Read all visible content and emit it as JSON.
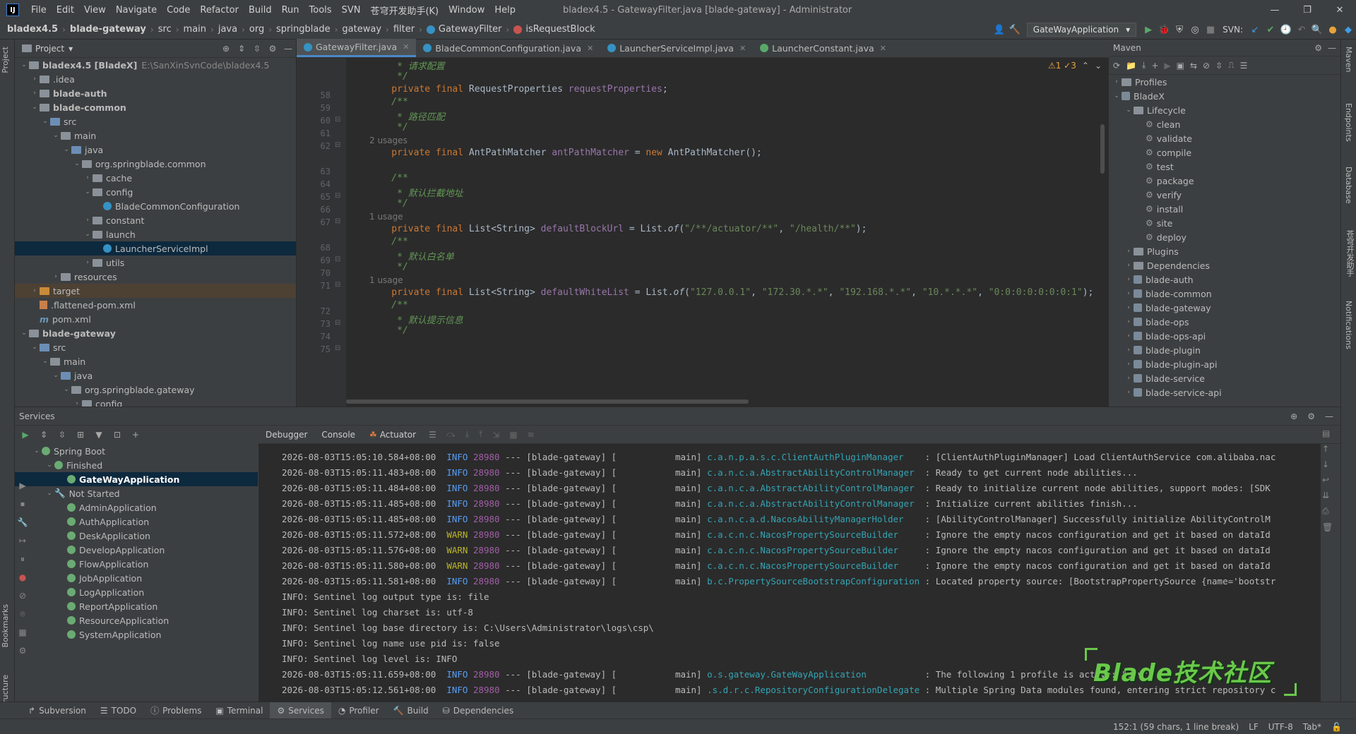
{
  "menubar": {
    "items": [
      "File",
      "Edit",
      "View",
      "Navigate",
      "Code",
      "Refactor",
      "Build",
      "Run",
      "Tools",
      "SVN",
      "苍穹开发助手(K)",
      "Window",
      "Help"
    ],
    "title": "bladex4.5 - GatewayFilter.java [blade-gateway] - Administrator"
  },
  "navbar": {
    "crumbs": [
      "bladex4.5",
      "blade-gateway",
      "src",
      "main",
      "java",
      "org",
      "springblade",
      "gateway",
      "filter",
      "GatewayFilter",
      "isRequestBlock"
    ],
    "run_config": "GateWayApplication",
    "svn_label": "SVN:"
  },
  "project": {
    "title": "Project",
    "items": [
      {
        "label": "bladex4.5 [BladeX]",
        "extra": "E:\\SanXinSvnCode\\bladex4.5",
        "bold": true
      },
      {
        "label": ".idea"
      },
      {
        "label": "blade-auth",
        "bold": true
      },
      {
        "label": "blade-common",
        "bold": true
      },
      {
        "label": "src"
      },
      {
        "label": "main"
      },
      {
        "label": "java"
      },
      {
        "label": "org.springblade.common"
      },
      {
        "label": "cache"
      },
      {
        "label": "config"
      },
      {
        "label": "BladeCommonConfiguration"
      },
      {
        "label": "constant"
      },
      {
        "label": "launch"
      },
      {
        "label": "LauncherServiceImpl"
      },
      {
        "label": "utils"
      },
      {
        "label": "resources"
      },
      {
        "label": "target"
      },
      {
        "label": ".flattened-pom.xml"
      },
      {
        "label": "pom.xml"
      },
      {
        "label": "blade-gateway",
        "bold": true
      },
      {
        "label": "src"
      },
      {
        "label": "main"
      },
      {
        "label": "java"
      },
      {
        "label": "org.springblade.gateway"
      },
      {
        "label": "config"
      }
    ]
  },
  "editor": {
    "tabs": [
      "GatewayFilter.java",
      "BladeCommonConfiguration.java",
      "LauncherServiceImpl.java",
      "LauncherConstant.java"
    ],
    "warnings": "⚠1 ✓3",
    "lines": [
      {
        "n": "",
        "t": "cm",
        "code": "     * 请求配置"
      },
      {
        "n": "58",
        "t": "cm",
        "code": "     */"
      },
      {
        "n": "59",
        "t": "code1",
        "code": ""
      },
      {
        "n": "60",
        "t": "cm",
        "code": "    /**"
      },
      {
        "n": "61",
        "t": "cm",
        "code": "     * 路径匹配"
      },
      {
        "n": "62",
        "t": "cm",
        "code": "     */"
      },
      {
        "n": "",
        "t": "usage",
        "code": "2 usages"
      },
      {
        "n": "63",
        "t": "code2",
        "code": ""
      },
      {
        "n": "64",
        "t": "blank",
        "code": ""
      },
      {
        "n": "65",
        "t": "cm",
        "code": "    /**"
      },
      {
        "n": "66",
        "t": "cm",
        "code": "     * 默认拦截地址"
      },
      {
        "n": "67",
        "t": "cm",
        "code": "     */"
      },
      {
        "n": "",
        "t": "usage",
        "code": "1 usage"
      },
      {
        "n": "68",
        "t": "code3",
        "code": ""
      },
      {
        "n": "69",
        "t": "cm",
        "code": "    /**"
      },
      {
        "n": "70",
        "t": "cm",
        "code": "     * 默认白名单"
      },
      {
        "n": "71",
        "t": "cm",
        "code": "     */"
      },
      {
        "n": "",
        "t": "usage",
        "code": "1 usage"
      },
      {
        "n": "72",
        "t": "code4",
        "code": ""
      },
      {
        "n": "73",
        "t": "cm",
        "code": "    /**"
      },
      {
        "n": "74",
        "t": "cm",
        "code": "     * 默认提示信息"
      },
      {
        "n": "75",
        "t": "cm",
        "code": "     */"
      }
    ],
    "code1": {
      "kw": "    private final ",
      "type": "RequestProperties ",
      "field": "requestProperties",
      ";": ";"
    },
    "code2": {
      "kw": "    private final ",
      "type": "AntPathMatcher ",
      "field": "antPathMatcher",
      "rest1": " = ",
      "new": "new ",
      "rest2": "AntPathMatcher();"
    },
    "code3": {
      "kw": "    private final ",
      "type": "List<String> ",
      "field": "defaultBlockUrl",
      "rest1": " = List.",
      "of": "of",
      "rest2": "(",
      "s1": "\"/**/actuator/**\"",
      "c": ", ",
      "s2": "\"/health/**\"",
      "end": ");"
    },
    "code4": {
      "kw": "    private final ",
      "type": "List<String> ",
      "field": "defaultWhiteList",
      "rest1": " = List.",
      "of": "of",
      "rest2": "(",
      "s1": "\"127.0.0.1\"",
      "c1": ", ",
      "s2": "\"172.30.*.*\"",
      "c2": ", ",
      "s3": "\"192.168.*.*\"",
      "c3": ", ",
      "s4": "\"10.*.*.*\"",
      "c4": ", ",
      "s5": "\"0:0:0:0:0:0:0:1\"",
      "end": ");"
    }
  },
  "maven": {
    "title": "Maven",
    "items": [
      {
        "label": "Profiles",
        "lvl": 0,
        "kind": "folder",
        "arr": "›"
      },
      {
        "label": "BladeX",
        "lvl": 0,
        "kind": "mvn",
        "arr": "⌄"
      },
      {
        "label": "Lifecycle",
        "lvl": 1,
        "kind": "folder",
        "arr": "⌄"
      },
      {
        "label": "clean",
        "lvl": 2,
        "kind": "gear"
      },
      {
        "label": "validate",
        "lvl": 2,
        "kind": "gear"
      },
      {
        "label": "compile",
        "lvl": 2,
        "kind": "gear"
      },
      {
        "label": "test",
        "lvl": 2,
        "kind": "gear"
      },
      {
        "label": "package",
        "lvl": 2,
        "kind": "gear"
      },
      {
        "label": "verify",
        "lvl": 2,
        "kind": "gear"
      },
      {
        "label": "install",
        "lvl": 2,
        "kind": "gear"
      },
      {
        "label": "site",
        "lvl": 2,
        "kind": "gear"
      },
      {
        "label": "deploy",
        "lvl": 2,
        "kind": "gear"
      },
      {
        "label": "Plugins",
        "lvl": 1,
        "kind": "folder",
        "arr": "›"
      },
      {
        "label": "Dependencies",
        "lvl": 1,
        "kind": "folder",
        "arr": "›"
      },
      {
        "label": "blade-auth",
        "lvl": 1,
        "kind": "mvn",
        "arr": "›"
      },
      {
        "label": "blade-common",
        "lvl": 1,
        "kind": "mvn",
        "arr": "›"
      },
      {
        "label": "blade-gateway",
        "lvl": 1,
        "kind": "mvn",
        "arr": "›"
      },
      {
        "label": "blade-ops",
        "lvl": 1,
        "kind": "mvn",
        "arr": "›"
      },
      {
        "label": "blade-ops-api",
        "lvl": 1,
        "kind": "mvn",
        "arr": "›"
      },
      {
        "label": "blade-plugin",
        "lvl": 1,
        "kind": "mvn",
        "arr": "›"
      },
      {
        "label": "blade-plugin-api",
        "lvl": 1,
        "kind": "mvn",
        "arr": "›"
      },
      {
        "label": "blade-service",
        "lvl": 1,
        "kind": "mvn",
        "arr": "›"
      },
      {
        "label": "blade-service-api",
        "lvl": 1,
        "kind": "mvn",
        "arr": "›"
      }
    ]
  },
  "services": {
    "title": "Services",
    "tree": [
      {
        "label": "Spring Boot",
        "lvl": 0,
        "arr": "⌄"
      },
      {
        "label": "Finished",
        "lvl": 1,
        "arr": "⌄"
      },
      {
        "label": "GateWayApplication",
        "lvl": 2,
        "sel": true
      },
      {
        "label": "Not Started",
        "lvl": 1,
        "arr": "⌄"
      },
      {
        "label": "AdminApplication",
        "lvl": 2
      },
      {
        "label": "AuthApplication",
        "lvl": 2
      },
      {
        "label": "DeskApplication",
        "lvl": 2
      },
      {
        "label": "DevelopApplication",
        "lvl": 2
      },
      {
        "label": "FlowApplication",
        "lvl": 2
      },
      {
        "label": "JobApplication",
        "lvl": 2
      },
      {
        "label": "LogApplication",
        "lvl": 2
      },
      {
        "label": "ReportApplication",
        "lvl": 2
      },
      {
        "label": "ResourceApplication",
        "lvl": 2
      },
      {
        "label": "SystemApplication",
        "lvl": 2
      }
    ],
    "console_tabs": [
      "Debugger",
      "Console",
      "Actuator"
    ],
    "logs": [
      {
        "ts": "2026-08-03T15:05:10.584+08:00",
        "lvl": "INFO",
        "pid": "28980",
        "th": " --- [blade-gateway] [           main] ",
        "lg": "c.a.n.p.a.s.c.ClientAuthPluginManager   ",
        "msg": " : [ClientAuthPluginManager] Load ClientAuthService com.alibaba.nac"
      },
      {
        "ts": "2026-08-03T15:05:11.483+08:00",
        "lvl": "INFO",
        "pid": "28980",
        "th": " --- [blade-gateway] [           main] ",
        "lg": "c.a.n.c.a.AbstractAbilityControlManager ",
        "msg": " : Ready to get current node abilities..."
      },
      {
        "ts": "2026-08-03T15:05:11.484+08:00",
        "lvl": "INFO",
        "pid": "28980",
        "th": " --- [blade-gateway] [           main] ",
        "lg": "c.a.n.c.a.AbstractAbilityControlManager ",
        "msg": " : Ready to initialize current node abilities, support modes: [SDK"
      },
      {
        "ts": "2026-08-03T15:05:11.485+08:00",
        "lvl": "INFO",
        "pid": "28980",
        "th": " --- [blade-gateway] [           main] ",
        "lg": "c.a.n.c.a.AbstractAbilityControlManager ",
        "msg": " : Initialize current abilities finish..."
      },
      {
        "ts": "2026-08-03T15:05:11.485+08:00",
        "lvl": "INFO",
        "pid": "28980",
        "th": " --- [blade-gateway] [           main] ",
        "lg": "c.a.n.c.a.d.NacosAbilityManagerHolder   ",
        "msg": " : [AbilityControlManager] Successfully initialize AbilityControlM"
      },
      {
        "ts": "2026-08-03T15:05:11.572+08:00",
        "lvl": "WARN",
        "pid": "28980",
        "th": " --- [blade-gateway] [           main] ",
        "lg": "c.a.c.n.c.NacosPropertySourceBuilder    ",
        "msg": " : Ignore the empty nacos configuration and get it based on dataId"
      },
      {
        "ts": "2026-08-03T15:05:11.576+08:00",
        "lvl": "WARN",
        "pid": "28980",
        "th": " --- [blade-gateway] [           main] ",
        "lg": "c.a.c.n.c.NacosPropertySourceBuilder    ",
        "msg": " : Ignore the empty nacos configuration and get it based on dataId"
      },
      {
        "ts": "2026-08-03T15:05:11.580+08:00",
        "lvl": "WARN",
        "pid": "28980",
        "th": " --- [blade-gateway] [           main] ",
        "lg": "c.a.c.n.c.NacosPropertySourceBuilder    ",
        "msg": " : Ignore the empty nacos configuration and get it based on dataId"
      },
      {
        "ts": "2026-08-03T15:05:11.581+08:00",
        "lvl": "INFO",
        "pid": "28980",
        "th": " --- [blade-gateway] [           main] ",
        "lg": "b.c.PropertySourceBootstrapConfiguration",
        "msg": " : Located property source: [BootstrapPropertySource {name='bootstr"
      },
      {
        "plain": "INFO: Sentinel log output type is: file"
      },
      {
        "plain": "INFO: Sentinel log charset is: utf-8"
      },
      {
        "plain": "INFO: Sentinel log base directory is: C:\\Users\\Administrator\\logs\\csp\\"
      },
      {
        "plain": "INFO: Sentinel log name use pid is: false"
      },
      {
        "plain": "INFO: Sentinel log level is: INFO"
      },
      {
        "ts": "2026-08-03T15:05:11.659+08:00",
        "lvl": "INFO",
        "pid": "28980",
        "th": " --- [blade-gateway] [           main] ",
        "lg": "o.s.gateway.GateWayApplication          ",
        "msg": " : The following 1 profile is active: \"dev\""
      },
      {
        "ts": "2026-08-03T15:05:12.561+08:00",
        "lvl": "INFO",
        "pid": "28980",
        "th": " --- [blade-gateway] [           main] ",
        "lg": ".s.d.r.c.RepositoryConfigurationDelegate",
        "msg": " : Multiple Spring Data modules found, entering strict repository c"
      }
    ]
  },
  "bottom_tabs": [
    "Subversion",
    "TODO",
    "Problems",
    "Terminal",
    "Services",
    "Profiler",
    "Build",
    "Dependencies"
  ],
  "status": {
    "position": "152:1 (59 chars, 1 line break)",
    "eol": "LF",
    "encoding": "UTF-8",
    "indent": "Tab*"
  },
  "watermark": "Blade技术社区",
  "side_tabs": {
    "left": [
      "Project",
      "Bookmarks",
      "Structure"
    ],
    "right": [
      "Maven",
      "Endpoints",
      "Database",
      "苍穹开发助手",
      "Notifications"
    ]
  }
}
